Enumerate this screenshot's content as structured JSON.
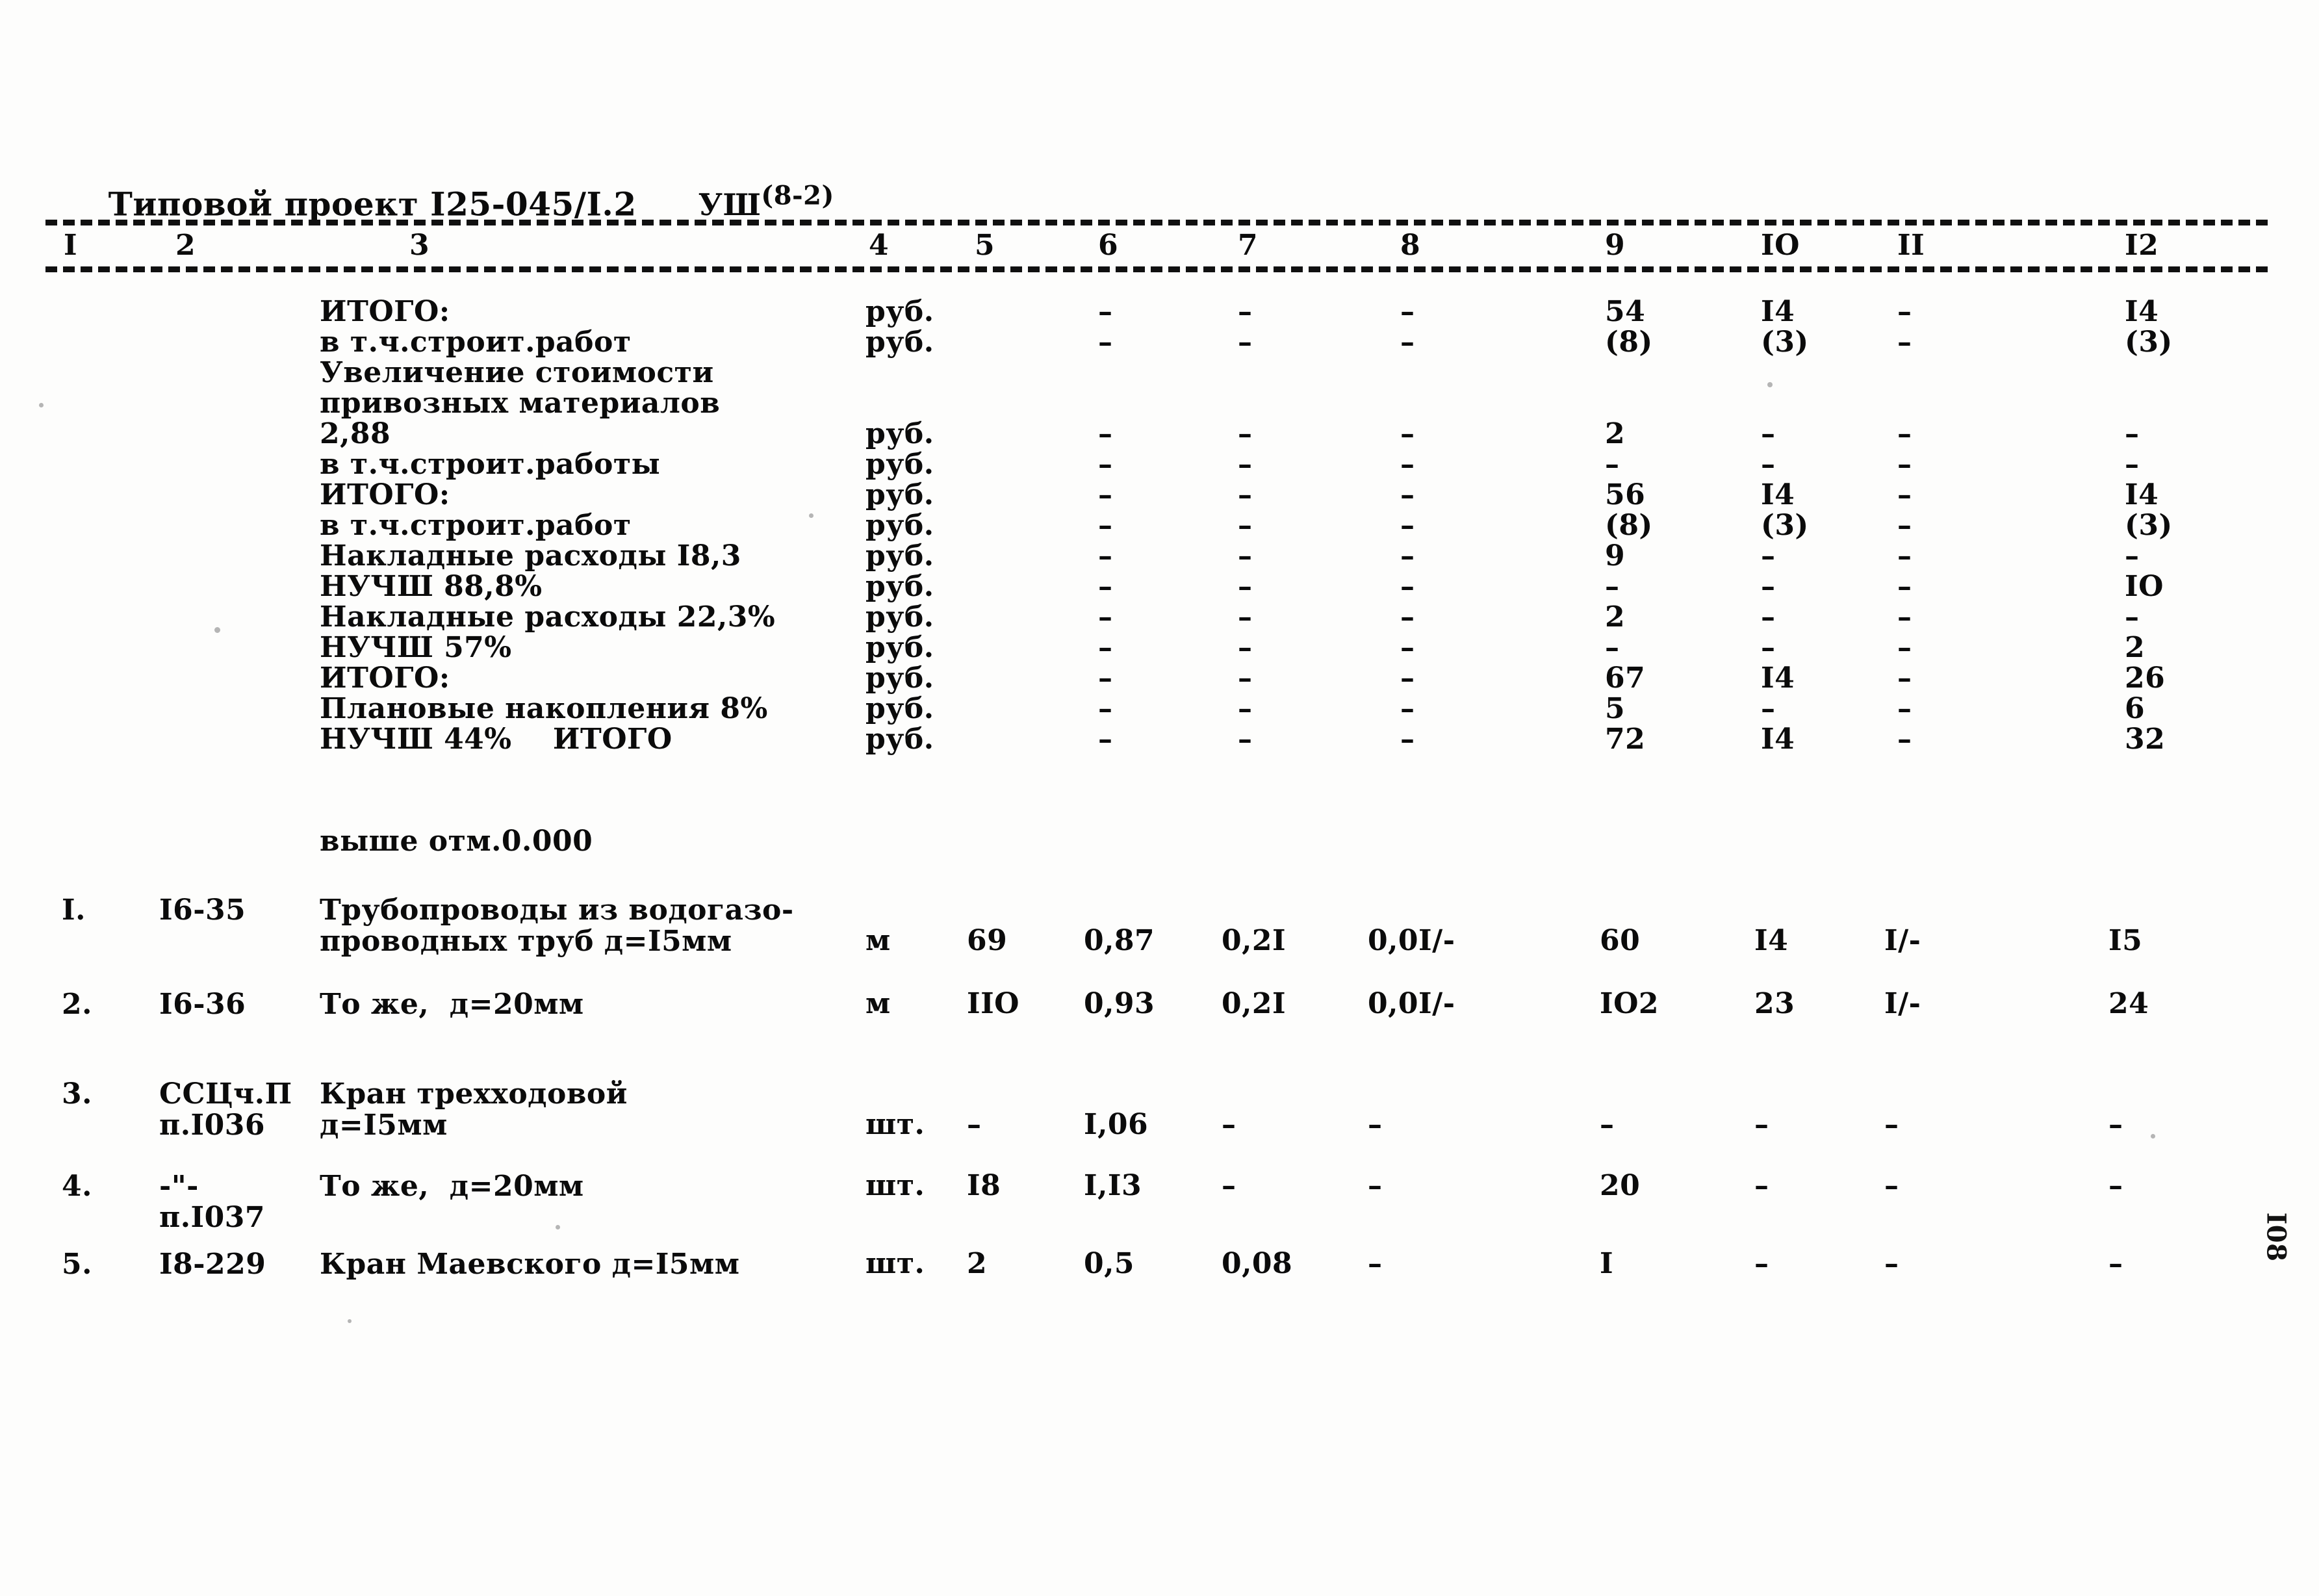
{
  "document": {
    "header_title": "Типовой проект I25-045/I.2",
    "sheet_code_base": "УШ",
    "sheet_code_sup": "(8-2)",
    "folio": "I08"
  },
  "table": {
    "column_headers": [
      "I",
      "2",
      "3",
      "4",
      "5",
      "6",
      "7",
      "8",
      "9",
      "IO",
      "II",
      "I2"
    ],
    "summary_rows": [
      {
        "label": "ИТОГО:",
        "unit": "руб.",
        "c5": "",
        "c6": "–",
        "c7": "–",
        "c8": "–",
        "c9": "54",
        "c10": "I4",
        "c11": "–",
        "c12": "I4"
      },
      {
        "label": "в т.ч.строит.работ",
        "unit": "руб.",
        "c5": "",
        "c6": "–",
        "c7": "–",
        "c8": "–",
        "c9": "(8)",
        "c10": "(3)",
        "c11": "–",
        "c12": "(3)"
      },
      {
        "label": "Увеличение стоимости",
        "unit": "",
        "c5": "",
        "c6": "",
        "c7": "",
        "c8": "",
        "c9": "",
        "c10": "",
        "c11": "",
        "c12": ""
      },
      {
        "label": "привозных материалов",
        "unit": "",
        "c5": "",
        "c6": "",
        "c7": "",
        "c8": "",
        "c9": "",
        "c10": "",
        "c11": "",
        "c12": ""
      },
      {
        "label": "2,88",
        "unit": "руб.",
        "c5": "",
        "c6": "–",
        "c7": "–",
        "c8": "–",
        "c9": "2",
        "c10": "–",
        "c11": "–",
        "c12": "–"
      },
      {
        "label": "в т.ч.строит.работы",
        "unit": "руб.",
        "c5": "",
        "c6": "–",
        "c7": "–",
        "c8": "–",
        "c9": "–",
        "c10": "–",
        "c11": "–",
        "c12": "–"
      },
      {
        "label": "ИТОГО:",
        "unit": "руб.",
        "c5": "",
        "c6": "–",
        "c7": "–",
        "c8": "–",
        "c9": "56",
        "c10": "I4",
        "c11": "–",
        "c12": "I4"
      },
      {
        "label": "в т.ч.строит.работ",
        "unit": "руб.",
        "c5": "",
        "c6": "–",
        "c7": "–",
        "c8": "–",
        "c9": "(8)",
        "c10": "(3)",
        "c11": "–",
        "c12": "(3)"
      },
      {
        "label": "Накладные расходы I8,3",
        "unit": "руб.",
        "c5": "",
        "c6": "–",
        "c7": "–",
        "c8": "–",
        "c9": "9",
        "c10": "–",
        "c11": "–",
        "c12": "–"
      },
      {
        "label": "НУЧШ 88,8%",
        "unit": "руб.",
        "c5": "",
        "c6": "–",
        "c7": "–",
        "c8": "–",
        "c9": "–",
        "c10": "–",
        "c11": "–",
        "c12": "IO"
      },
      {
        "label": "Накладные расходы 22,3%",
        "unit": "руб.",
        "c5": "",
        "c6": "–",
        "c7": "–",
        "c8": "–",
        "c9": "2",
        "c10": "–",
        "c11": "–",
        "c12": "–"
      },
      {
        "label": "НУЧШ 57%",
        "unit": "руб.",
        "c5": "",
        "c6": "–",
        "c7": "–",
        "c8": "–",
        "c9": "–",
        "c10": "–",
        "c11": "–",
        "c12": "2"
      },
      {
        "label": "ИТОГО:",
        "unit": "руб.",
        "c5": "",
        "c6": "–",
        "c7": "–",
        "c8": "–",
        "c9": "67",
        "c10": "I4",
        "c11": "–",
        "c12": "26"
      },
      {
        "label": "Плановые накопления 8%",
        "unit": "руб.",
        "c5": "",
        "c6": "–",
        "c7": "–",
        "c8": "–",
        "c9": "5",
        "c10": "–",
        "c11": "–",
        "c12": "6"
      },
      {
        "label": "НУЧШ 44%    ИТОГО",
        "unit": "руб.",
        "c5": "",
        "c6": "–",
        "c7": "–",
        "c8": "–",
        "c9": "72",
        "c10": "I4",
        "c11": "–",
        "c12": "32"
      }
    ],
    "section_caption": "выше отм.0.000",
    "item_rows": [
      {
        "no": "I.",
        "code": "I6-35",
        "code2": "",
        "desc1": "Трубопроводы из водогазо-",
        "desc2": "проводных труб д=I5мм",
        "unit": "м",
        "c5": "69",
        "c6": "0,87",
        "c7": "0,2I",
        "c8": "0,0I/-",
        "c9": "60",
        "c10": "I4",
        "c11": "I/-",
        "c12": "I5"
      },
      {
        "no": "2.",
        "code": "I6-36",
        "code2": "",
        "desc1": "То же,  д=20мм",
        "desc2": "",
        "unit": "м",
        "c5": "IIO",
        "c6": "0,93",
        "c7": "0,2I",
        "c8": "0,0I/-",
        "c9": "IO2",
        "c10": "23",
        "c11": "I/-",
        "c12": "24"
      },
      {
        "no": "3.",
        "code": "ССЦч.П",
        "code2": "п.I036",
        "desc1": "Кран трехходовой",
        "desc2": "д=I5мм",
        "unit": "шт.",
        "c5": "–",
        "c6": "I,06",
        "c7": "–",
        "c8": "–",
        "c9": "–",
        "c10": "–",
        "c11": "–",
        "c12": "–"
      },
      {
        "no": "4.",
        "code": "-\"-",
        "code2": "п.I037",
        "desc1": "То же,  д=20мм",
        "desc2": "",
        "unit": "шт.",
        "c5": "I8",
        "c6": "I,I3",
        "c7": "–",
        "c8": "–",
        "c9": "20",
        "c10": "–",
        "c11": "–",
        "c12": "–"
      },
      {
        "no": "5.",
        "code": "I8-229",
        "code2": "",
        "desc1": "Кран Маевского д=I5мм",
        "desc2": "",
        "unit": "шт.",
        "c5": "2",
        "c6": "0,5",
        "c7": "0,08",
        "c8": "–",
        "c9": "I",
        "c10": "–",
        "c11": "–",
        "c12": "–"
      }
    ]
  }
}
